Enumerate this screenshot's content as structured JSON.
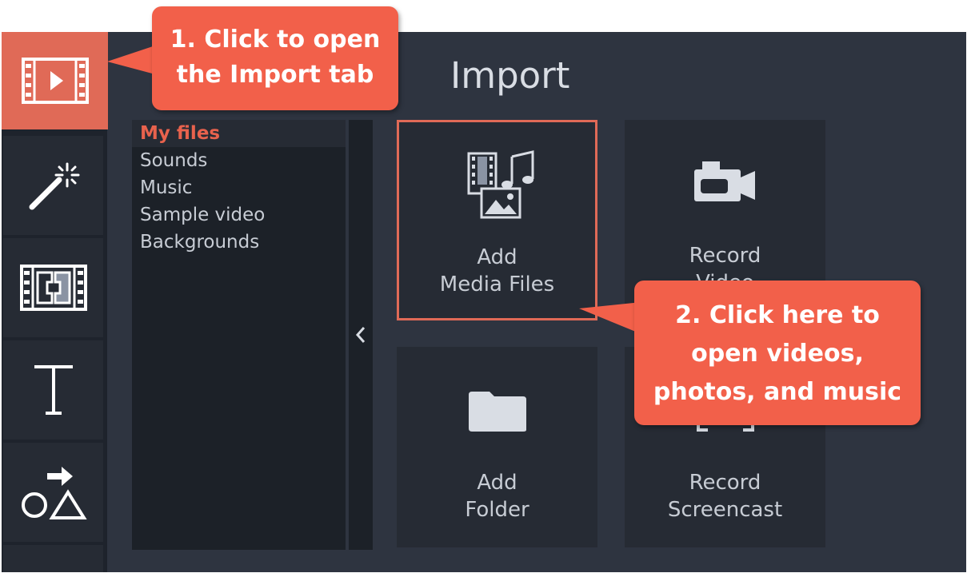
{
  "colors": {
    "accent": "#f2604a",
    "active_tab": "#e06a57",
    "panel_bg": "#2e3440",
    "sidebar_bg": "#1e232c",
    "selected_text": "#e8624d"
  },
  "toolbar": {
    "tabs": [
      {
        "icon": "film-play-icon",
        "active": true
      },
      {
        "icon": "magic-wand-icon",
        "active": false
      },
      {
        "icon": "transition-film-icon",
        "active": false
      },
      {
        "icon": "text-icon",
        "active": false
      },
      {
        "icon": "shapes-arrow-icon",
        "active": false
      }
    ]
  },
  "panel": {
    "title": "Import"
  },
  "file_list": {
    "items": [
      "My files",
      "Sounds",
      "Music",
      "Sample video",
      "Backgrounds"
    ],
    "selected": "My files",
    "collapse_icon": "chevron-left-icon"
  },
  "tiles": {
    "add_media": {
      "line1": "Add",
      "line2": "Media Files",
      "icon": "media-files-icon"
    },
    "record_video": {
      "line1": "Record",
      "line2": "Video",
      "icon": "video-camera-icon"
    },
    "add_folder": {
      "line1": "Add",
      "line2": "Folder",
      "icon": "folder-icon"
    },
    "record_screencast": {
      "line1": "Record",
      "line2": "Screencast",
      "icon": "screencast-icon"
    }
  },
  "callouts": {
    "step1": {
      "line1": "1. Click to open",
      "line2": "the Import tab"
    },
    "step2": {
      "line1": "2. Click here to",
      "line2": "open videos,",
      "line3": "photos, and music"
    }
  }
}
